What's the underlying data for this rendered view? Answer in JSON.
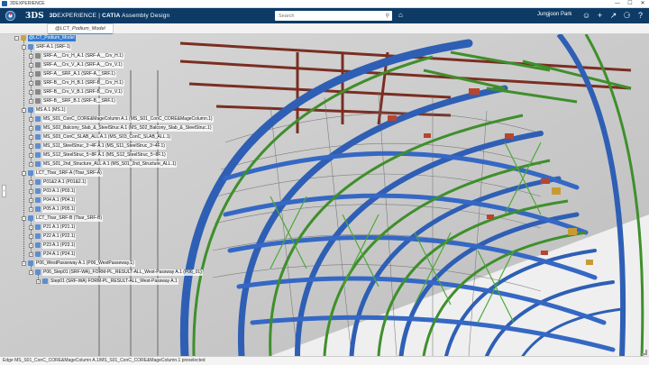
{
  "os_window": {
    "title": "3DEXPERIENCE",
    "controls": [
      "—",
      "☐",
      "✕"
    ]
  },
  "header": {
    "logo": "3DS",
    "brand_prefix": "3D",
    "brand_main": "EXPERIENCE",
    "brand_sep": " | ",
    "brand_app": "CATIA",
    "brand_module": " Assembly Design",
    "search": {
      "value": "",
      "placeholder": "Search"
    },
    "user_name": "Jungjoon Park",
    "icons": [
      "user-icon",
      "plus-icon",
      "share-icon",
      "network-icon",
      "help-icon"
    ]
  },
  "tabs": [
    {
      "label": "@LCT_Podium_Model"
    }
  ],
  "tree": {
    "nodes": [
      {
        "label": "@LCT_Podium_Model",
        "selected": true
      },
      {
        "label": "SRF-A.1 (SRF-1)"
      },
      {
        "label": "SRF-A__Crv_H_A.1 (SRF-A__Crv_H.1)"
      },
      {
        "label": "SRF-A__Crv_V_A.1 (SRF-A__Crv_V.1)"
      },
      {
        "label": "SRF-A__SRF_A.1 (SRF-A__SRF.1)"
      },
      {
        "label": "SRF-B__Crv_H_B.1 (SRF-B__Crv_H.1)"
      },
      {
        "label": "SRF-B__Crv_V_B.1 (SRF-B__Crv_V.1)"
      },
      {
        "label": "SRF-B__SRF_B.1 (SRF-B__SRF.1)"
      },
      {
        "label": "MS A.1 (MS.1)"
      },
      {
        "label": "MS_S01_ConC_CORE&MageColumn A.1 (MS_S01_ConC_CORE&MageColumn.1)"
      },
      {
        "label": "MS_S02_Balcony_Slab_&_SteelStruc A.1 (MS_S02_Balcony_Slab_&_SteelStruc.1)"
      },
      {
        "label": "MS_S03_ConC_SLAB_ALL A.1 (MS_S03_ConC_SLAB_ALL.1)"
      },
      {
        "label": "MS_S11_SteelStruc_3~4F A.1 (MS_S11_SteelStruc_3~4F.1)"
      },
      {
        "label": "MS_S12_SteelStruc_5~8F A.1 (MS_S12_SteelStruc_5~8F.1)"
      },
      {
        "label": "MS_S01_2nd_Structure_ALL A.1 (MS_S01_2nd_Structure_ALL.1)"
      },
      {
        "label": "LCT_Tbar_SRF-A (Tbar_SRF-A)"
      },
      {
        "label": "P01&2 A.1 (P01&2.1)"
      },
      {
        "label": "P03 A.1 (P03.1)"
      },
      {
        "label": "P04 A.1 (P04.1)"
      },
      {
        "label": "P05 A.1 (P05.1)"
      },
      {
        "label": "LCT_Tbar_SRF-B (Tbar_SRF-B)"
      },
      {
        "label": "P21 A.1 (P21.1)"
      },
      {
        "label": "P22 A.1 (P22.1)"
      },
      {
        "label": "P23 A.1 (P23.1)"
      },
      {
        "label": "P24 A.1 (P24.1)"
      },
      {
        "label": "P06_WestPasseway A.1 (P06_WestPasseway.1)"
      },
      {
        "label": "P06_Step01 (SRF-WA)_FORM-PL_RESULT-ALL_West-Passway A.1 (P06_01)"
      },
      {
        "label": "Step01 (SRF-WA) FORM-PL_RESULT-ALL_West-Passway A.1"
      }
    ]
  },
  "status_bar": {
    "text": "Edge MS_S01_ConC_CORE&MageColumn A.1/MS_S01_ConC_CORE&MageColumn.1 preselected"
  },
  "colors": {
    "header_bg": "#0d3b66",
    "selection": "#2f7dd6",
    "steel_blue": "#2e5fb5",
    "steel_green": "#3a8a2a",
    "beam_red": "#8a3a2a"
  }
}
